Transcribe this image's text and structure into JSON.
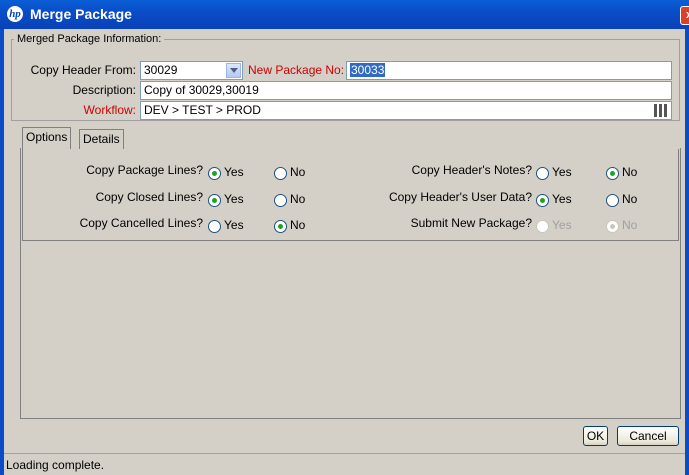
{
  "window": {
    "title": "Merge Package",
    "logo": "hp",
    "close_glyph": "x"
  },
  "section": {
    "legend": "Merged Package Information:"
  },
  "form": {
    "copy_header_from": {
      "label": "Copy Header From:",
      "value": "30029"
    },
    "new_package_no": {
      "label": "New Package No:",
      "value": "30033"
    },
    "description": {
      "label": "Description:",
      "value": "Copy of 30029,30019"
    },
    "workflow": {
      "label": "Workflow:",
      "value": "DEV > TEST > PROD"
    }
  },
  "tabs": [
    {
      "label": "Options",
      "active": true
    },
    {
      "label": "Details",
      "active": false
    }
  ],
  "options": {
    "copy_package_lines": {
      "label": "Copy Package Lines?",
      "yes": "Yes",
      "no": "No",
      "selected": "Yes"
    },
    "copy_closed_lines": {
      "label": "Copy Closed Lines?",
      "yes": "Yes",
      "no": "No",
      "selected": "Yes"
    },
    "copy_cancelled_lines": {
      "label": "Copy Cancelled Lines?",
      "yes": "Yes",
      "no": "No",
      "selected": "No"
    },
    "copy_header_notes": {
      "label": "Copy Header's Notes?",
      "yes": "Yes",
      "no": "No",
      "selected": "No"
    },
    "copy_header_user_data": {
      "label": "Copy Header's User Data?",
      "yes": "Yes",
      "no": "No",
      "selected": "Yes"
    },
    "submit_new_package": {
      "label": "Submit New Package?",
      "yes": "Yes",
      "no": "No",
      "selected": "No",
      "disabled": true
    }
  },
  "buttons": {
    "ok": "OK",
    "cancel": "Cancel"
  },
  "status": {
    "text": "Loading complete."
  },
  "colors": {
    "titlebar": "#0a4bc7",
    "required_label": "#cc0000",
    "selection": "#316ac5",
    "radio_dot": "#21a121"
  },
  "icons": {
    "dropdown": "chevron-down-icon",
    "workflow_picker": "workflow-picker-icon"
  }
}
